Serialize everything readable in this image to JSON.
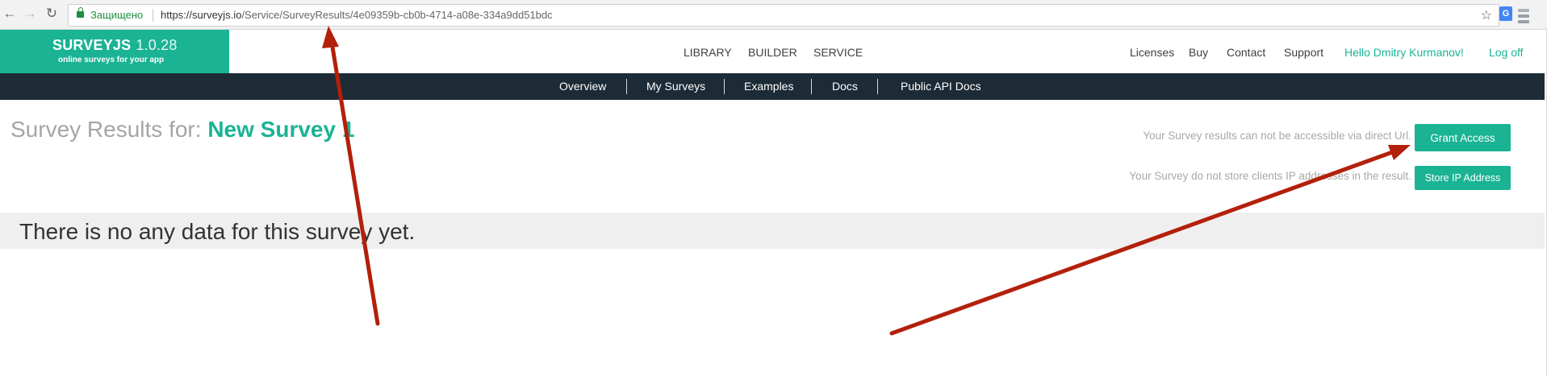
{
  "browser": {
    "secure_label": "Защищено",
    "url_host": "https://surveyjs.io",
    "url_path": "/Service/SurveyResults/4e09359b-cb0b-4714-a08e-334a9dd51bdc",
    "icons": {
      "back": "arrow-left-icon",
      "forward": "arrow-right-icon",
      "reload": "reload-icon",
      "lock": "lock-icon",
      "bookmark": "star-icon",
      "translate": "translate-icon",
      "extension": "extension-menu-icon"
    },
    "translate_glyph": "G"
  },
  "header": {
    "logo_title": "SURVEYJS",
    "logo_version": "1.0.28",
    "logo_sub": "online surveys for your app",
    "main_nav": [
      "LIBRARY",
      "BUILDER",
      "SERVICE"
    ],
    "right_nav": [
      "Licenses",
      "Buy",
      "Contact",
      "Support"
    ],
    "greeting": "Hello Dmitry Kurmanov!",
    "logout": "Log off"
  },
  "subnav": [
    "Overview",
    "My Surveys",
    "Examples",
    "Docs",
    "Public API Docs"
  ],
  "content": {
    "title_prefix": "Survey Results for:",
    "survey_name": "New Survey 1",
    "direct_url_notice": "Your Survey results can not be accessible via direct Url.",
    "grant_access_label": "Grant Access",
    "ip_notice": "Your Survey do not store clients IP addresses in the result.",
    "store_ip_label": "Store IP Address",
    "no_data": "There is no any data for this survey yet."
  },
  "colors": {
    "brand_green": "#1ab394",
    "subnav_bg": "#1c2b36",
    "annotation_red": "#b3200b"
  }
}
